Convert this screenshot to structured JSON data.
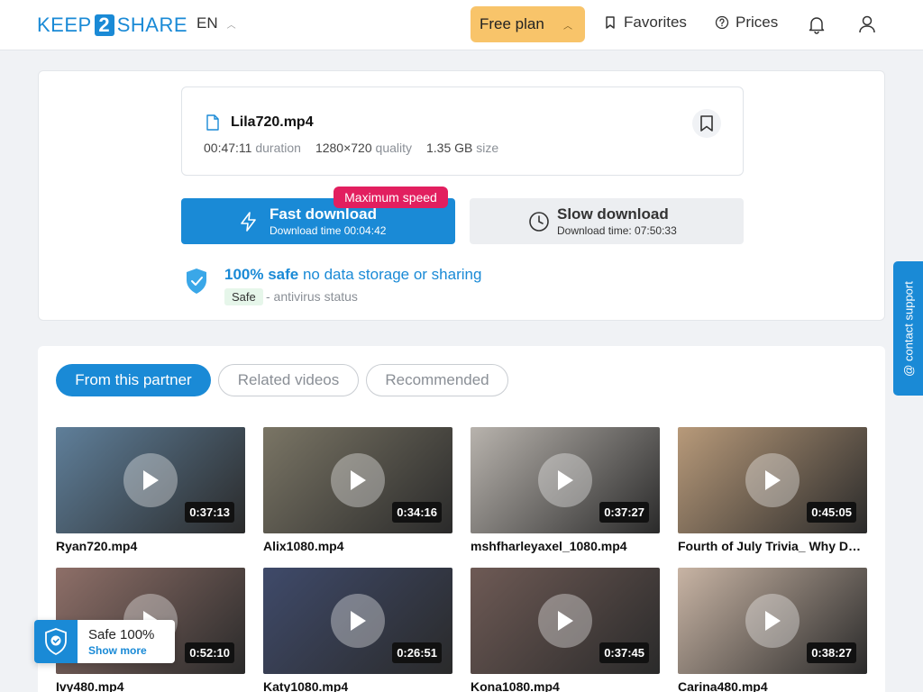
{
  "header": {
    "logo": {
      "pre": "KEEP",
      "num": "2",
      "post": "SHARE"
    },
    "lang": "EN",
    "plan": "Free plan",
    "favorites": "Favorites",
    "prices": "Prices",
    "icons": [
      "chevron-up-icon",
      "bookmark-icon",
      "help-circle-icon",
      "bell-icon",
      "user-icon"
    ]
  },
  "file": {
    "name": "Lila720.mp4",
    "duration_value": "00:47:11",
    "duration_unit": "duration",
    "quality_value": "1280×720",
    "quality_unit": "quality",
    "size_value": "1.35 GB",
    "size_unit": "size"
  },
  "download": {
    "badge": "Maximum speed",
    "fast_title": "Fast download",
    "fast_sub": "Download time 00:04:42",
    "slow_title": "Slow download",
    "slow_sub": "Download time: 07:50:33"
  },
  "safety": {
    "bold": "100% safe",
    "rest": " no data storage or sharing",
    "pill": "Safe",
    "status": "- antivirus status"
  },
  "tabs": [
    "From this partner",
    "Related videos",
    "Recommended"
  ],
  "videos": [
    {
      "title": "Ryan720.mp4",
      "duration": "0:37:13",
      "bg": "#5f7f9a"
    },
    {
      "title": "Alix1080.mp4",
      "duration": "0:34:16",
      "bg": "#7a7565"
    },
    {
      "title": "mshfharleyaxel_1080.mp4",
      "duration": "0:37:27",
      "bg": "#b8b3ad"
    },
    {
      "title": "Fourth of July Trivia_ Why Do Y...",
      "duration": "0:45:05",
      "bg": "#b89a7a"
    },
    {
      "title": "Ivy480.mp4",
      "duration": "0:52:10",
      "bg": "#8e6f68"
    },
    {
      "title": "Katy1080.mp4",
      "duration": "0:26:51",
      "bg": "#3f4a6a"
    },
    {
      "title": "Kona1080.mp4",
      "duration": "0:37:45",
      "bg": "#6e5a55"
    },
    {
      "title": "Carina480.mp4",
      "duration": "0:38:27",
      "bg": "#c8b4a4"
    }
  ],
  "support": "@ contact support",
  "safe_widget": {
    "title": "Safe 100%",
    "link": "Show more"
  },
  "colors": {
    "accent": "#1a8ad6",
    "plan": "#f8c46a",
    "badge": "#e21f5f"
  }
}
